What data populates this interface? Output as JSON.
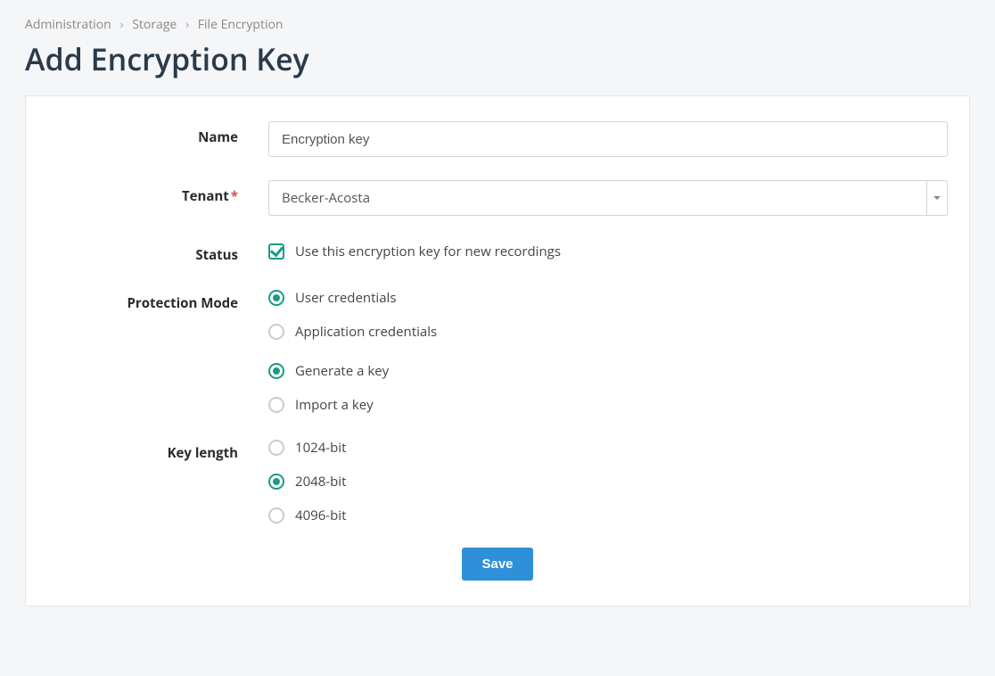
{
  "breadcrumb": {
    "items": [
      "Administration",
      "Storage",
      "File Encryption"
    ]
  },
  "page_title": "Add Encryption Key",
  "form": {
    "name": {
      "label": "Name",
      "value": "Encryption key"
    },
    "tenant": {
      "label": "Tenant",
      "required": true,
      "value": "Becker-Acosta"
    },
    "status": {
      "label": "Status",
      "checkbox_label": "Use this encryption key for new recordings",
      "checked": true
    },
    "protection_mode": {
      "label": "Protection Mode",
      "options": [
        {
          "label": "User credentials",
          "selected": true
        },
        {
          "label": "Application credentials",
          "selected": false
        }
      ]
    },
    "key_source": {
      "options": [
        {
          "label": "Generate a key",
          "selected": true
        },
        {
          "label": "Import a key",
          "selected": false
        }
      ]
    },
    "key_length": {
      "label": "Key length",
      "options": [
        {
          "label": "1024-bit",
          "selected": false
        },
        {
          "label": "2048-bit",
          "selected": true
        },
        {
          "label": "4096-bit",
          "selected": false
        }
      ]
    },
    "save_label": "Save"
  },
  "colors": {
    "accent_green": "#1a9c84",
    "primary_blue": "#2f8fd8",
    "required_red": "#d9534f"
  }
}
